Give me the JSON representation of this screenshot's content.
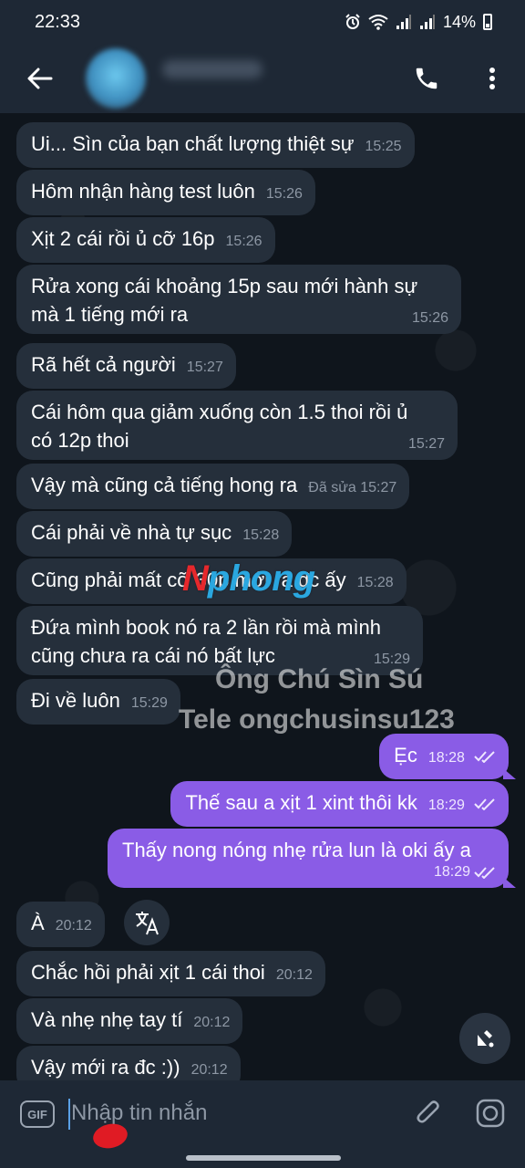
{
  "status_bar": {
    "time": "22:33",
    "battery": "14%"
  },
  "header": {
    "contact_name": "",
    "call_icon": "phone-icon",
    "menu_icon": "more-vert-icon"
  },
  "messages": [
    {
      "dir": "in",
      "text": "Ui... Sìn của bạn chất lượng thiệt sự",
      "time": "15:25"
    },
    {
      "dir": "in",
      "text": "Hôm nhận hàng test luôn",
      "time": "15:26"
    },
    {
      "dir": "in",
      "text": "Xịt 2 cái rồi ủ cỡ 16p",
      "time": "15:26"
    },
    {
      "dir": "in",
      "text": "Rửa xong cái khoảng 15p sau mới hành sự\nmà 1 tiếng mới ra",
      "time": "15:26"
    },
    {
      "dir": "in",
      "text": "Rã hết cả người",
      "time": "15:27"
    },
    {
      "dir": "in",
      "text": "Cái hôm qua giảm xuống còn 1.5 thoi rồi ủ\ncó 12p thoi",
      "time": "15:27"
    },
    {
      "dir": "in",
      "text": "Vậy mà cũng cả tiếng hong ra",
      "time": "Đã sửa 15:27"
    },
    {
      "dir": "in",
      "text": "Cái phải về nhà tự sục",
      "time": "15:28"
    },
    {
      "dir": "in",
      "text": "Cũng phải mất cỡ 30p mới ra đc ấy",
      "time": "15:28"
    },
    {
      "dir": "in",
      "text": "Đứa mình book nó ra 2 lần rồi mà mình\ncũng chưa ra cái nó bất lực",
      "time": "15:29"
    },
    {
      "dir": "in",
      "text": "Đi về luôn",
      "time": "15:29"
    },
    {
      "dir": "out",
      "text": "Ẹc",
      "time": "18:28"
    },
    {
      "dir": "out",
      "text": "Thế sau a xịt 1 xint thôi kk",
      "time": "18:29"
    },
    {
      "dir": "out",
      "text": "Thấy nong nóng nhẹ rửa lun là oki ấy a",
      "time": "18:29"
    },
    {
      "dir": "in",
      "text": "À",
      "time": "20:12"
    },
    {
      "dir": "in",
      "text": "Chắc hồi phải xịt 1 cái thoi",
      "time": "20:12"
    },
    {
      "dir": "in",
      "text": "Và nhẹ nhẹ tay tí",
      "time": "20:12"
    },
    {
      "dir": "in",
      "text": "Vậy mới ra đc :))",
      "time": "20:12"
    }
  ],
  "watermark": {
    "logo_red": "N",
    "logo_blue": "phong",
    "line1": "Ông Chú Sìn Sú",
    "line2": "Tele ongchusinsu123"
  },
  "input": {
    "placeholder": "Nhập tin nhắn",
    "gif_label": "GIF"
  },
  "colors": {
    "outgoing_bubble": "#8a5ce6",
    "incoming_bubble": "#252f3b",
    "background": "#0f151c",
    "bar": "#1e2835"
  }
}
